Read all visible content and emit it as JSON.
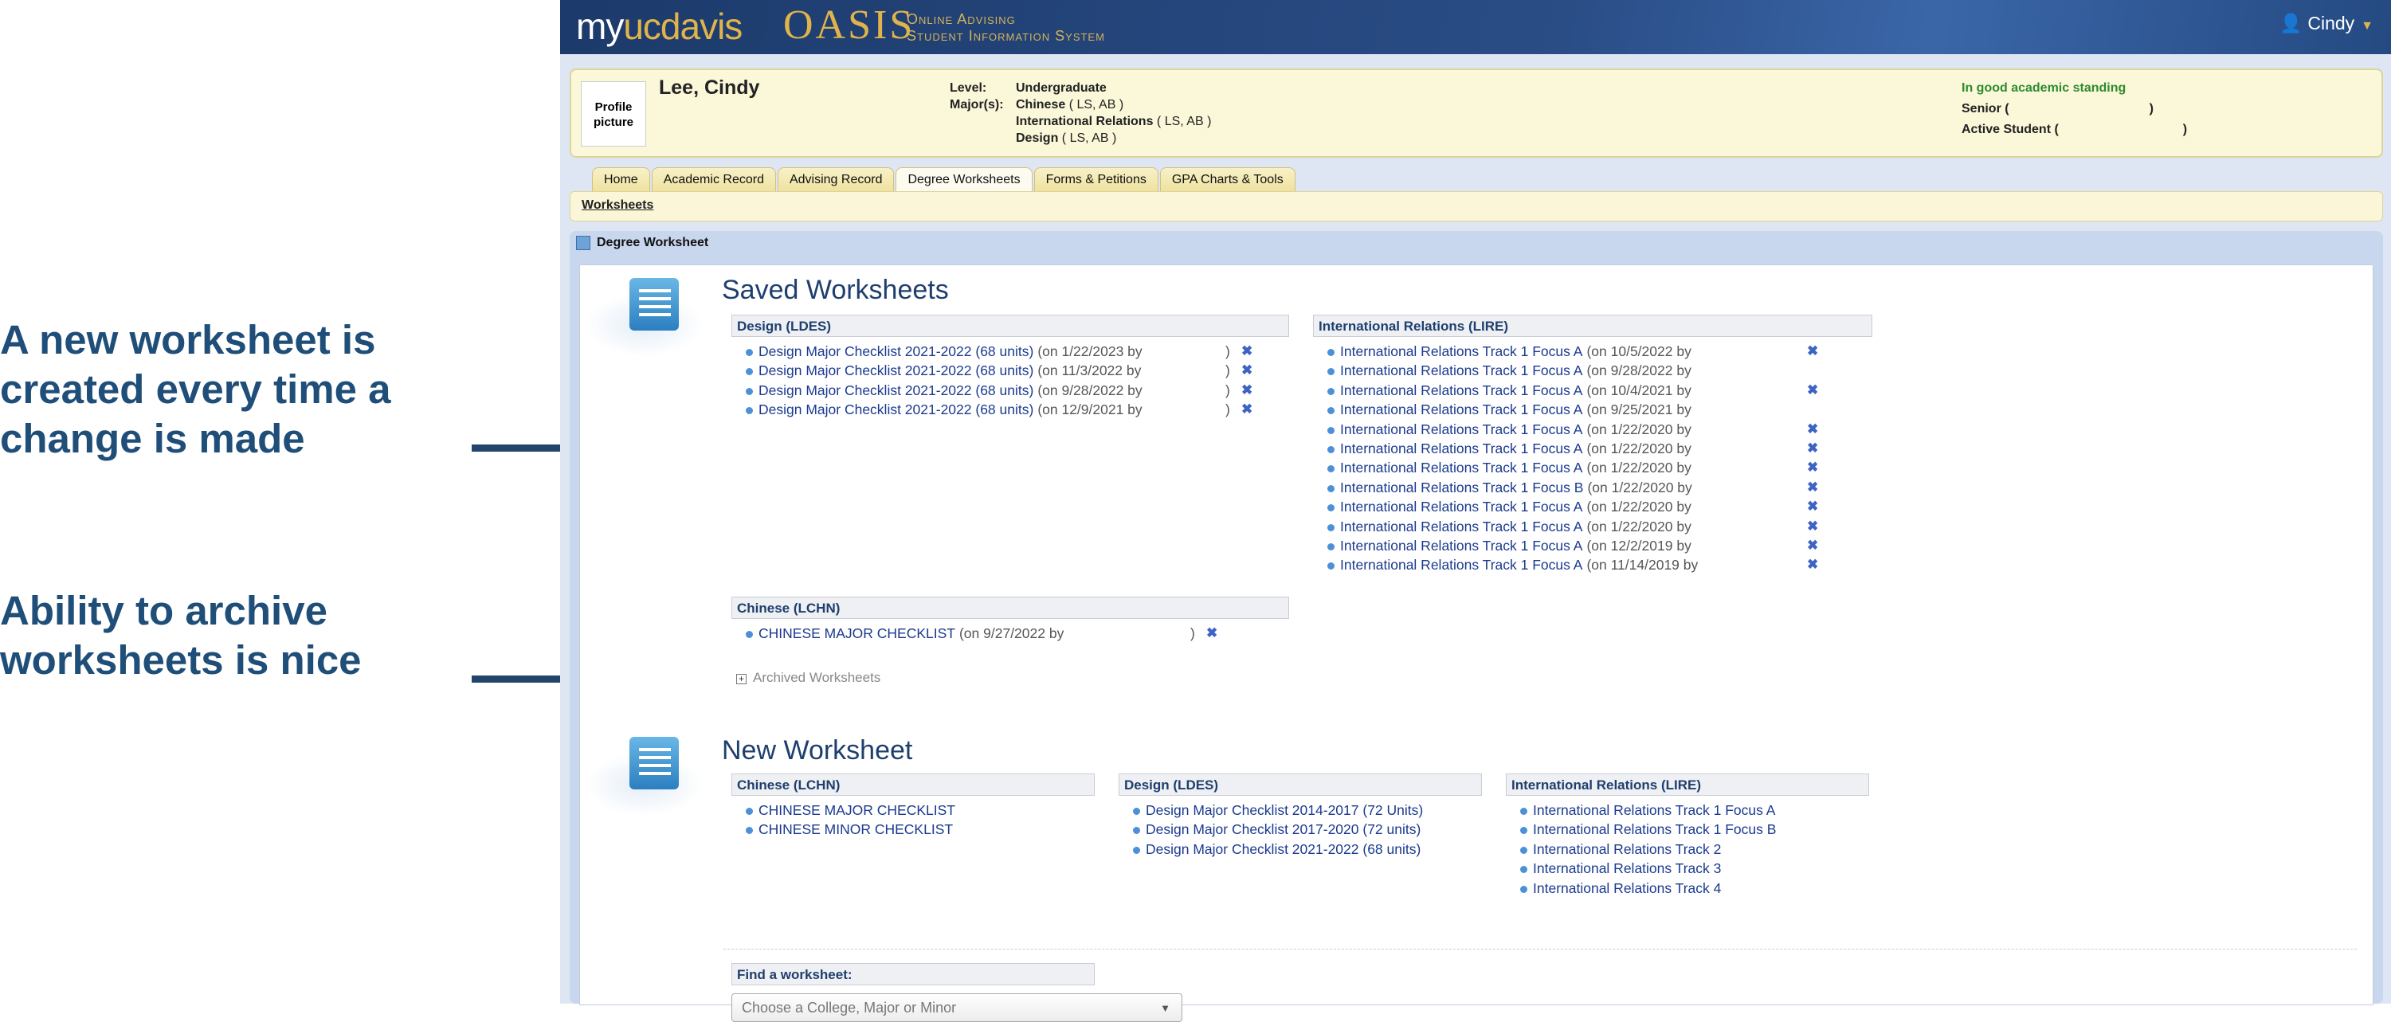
{
  "annotations": {
    "first": "A new worksheet is created every time a change is made",
    "second": "Ability to archive worksheets is nice"
  },
  "header": {
    "logo_my": "my",
    "logo_ucdavis": "ucdavis",
    "logo_oasis": "OASIS",
    "logo_sub_line1": "Online Advising",
    "logo_sub_line2": "Student Information System",
    "user": "Cindy"
  },
  "profile": {
    "picture_label": "Profile picture",
    "name": "Lee, Cindy",
    "level_label": "Level:",
    "majors_label": "Major(s):",
    "level": "Undergraduate",
    "majors": [
      {
        "name": "Chinese",
        "codes": "( LS, AB )"
      },
      {
        "name": "International Relations",
        "codes": "( LS, AB )"
      },
      {
        "name": "Design",
        "codes": "( LS, AB )"
      }
    ],
    "standing": "In good academic standing",
    "class": "Senior (",
    "class_end": ")",
    "status": "Active Student (",
    "status_end": ")"
  },
  "tabs": [
    "Home",
    "Academic Record",
    "Advising Record",
    "Degree Worksheets",
    "Forms & Petitions",
    "GPA Charts & Tools"
  ],
  "active_tab": "Degree Worksheets",
  "subnav": "Worksheets",
  "panel_title": "Degree Worksheet",
  "saved": {
    "title": "Saved Worksheets",
    "design": {
      "header": "Design (LDES)",
      "items": [
        {
          "link": "Design Major Checklist 2021-2022 (68 units)",
          "meta": "(on 1/22/2023 by",
          "end": ")"
        },
        {
          "link": "Design Major Checklist 2021-2022 (68 units)",
          "meta": "(on 11/3/2022 by",
          "end": ")"
        },
        {
          "link": "Design Major Checklist 2021-2022 (68 units)",
          "meta": "(on 9/28/2022 by",
          "end": ")"
        },
        {
          "link": "Design Major Checklist 2021-2022 (68 units)",
          "meta": "(on 12/9/2021 by",
          "end": ")"
        }
      ]
    },
    "ir": {
      "header": "International Relations (LIRE)",
      "items": [
        {
          "link": "International Relations Track 1 Focus A",
          "meta": "(on 10/5/2022 by",
          "del": true
        },
        {
          "link": "International Relations Track 1 Focus A",
          "meta": "(on 9/28/2022 by",
          "del": false
        },
        {
          "link": "International Relations Track 1 Focus A",
          "meta": "(on 10/4/2021 by",
          "del": true
        },
        {
          "link": "International Relations Track 1 Focus A",
          "meta": "(on 9/25/2021 by",
          "del": false
        },
        {
          "link": "International Relations Track 1 Focus A",
          "meta": "(on 1/22/2020 by",
          "del": true
        },
        {
          "link": "International Relations Track 1 Focus A",
          "meta": "(on 1/22/2020 by",
          "del": true
        },
        {
          "link": "International Relations Track 1 Focus A",
          "meta": "(on 1/22/2020 by",
          "del": true
        },
        {
          "link": "International Relations Track 1 Focus B",
          "meta": "(on 1/22/2020 by",
          "del": true
        },
        {
          "link": "International Relations Track 1 Focus A",
          "meta": "(on 1/22/2020 by",
          "del": true
        },
        {
          "link": "International Relations Track 1 Focus A",
          "meta": "(on 1/22/2020 by",
          "del": true
        },
        {
          "link": "International Relations Track 1 Focus A",
          "meta": "(on 12/2/2019 by",
          "del": true
        },
        {
          "link": "International Relations Track 1 Focus A",
          "meta": "(on 11/14/2019 by",
          "del": true
        }
      ]
    },
    "chinese": {
      "header": "Chinese (LCHN)",
      "items": [
        {
          "link": "CHINESE MAJOR CHECKLIST",
          "meta": "(on 9/27/2022 by",
          "end": ")"
        }
      ]
    },
    "archived_label": "Archived Worksheets"
  },
  "new": {
    "title": "New Worksheet",
    "chinese": {
      "header": "Chinese (LCHN)",
      "items": [
        "CHINESE MAJOR CHECKLIST",
        "CHINESE MINOR CHECKLIST"
      ]
    },
    "design": {
      "header": "Design (LDES)",
      "items": [
        "Design Major Checklist 2014-2017 (72 Units)",
        "Design Major Checklist 2017-2020 (72 units)",
        "Design Major Checklist 2021-2022 (68 units)"
      ]
    },
    "ir": {
      "header": "International Relations (LIRE)",
      "items": [
        "International Relations Track 1 Focus A",
        "International Relations Track 1 Focus B",
        "International Relations Track 2",
        "International Relations Track 3",
        "International Relations Track 4"
      ]
    }
  },
  "find": {
    "label": "Find a worksheet:",
    "placeholder": "Choose a College, Major or Minor"
  },
  "delete_glyph": "✖"
}
